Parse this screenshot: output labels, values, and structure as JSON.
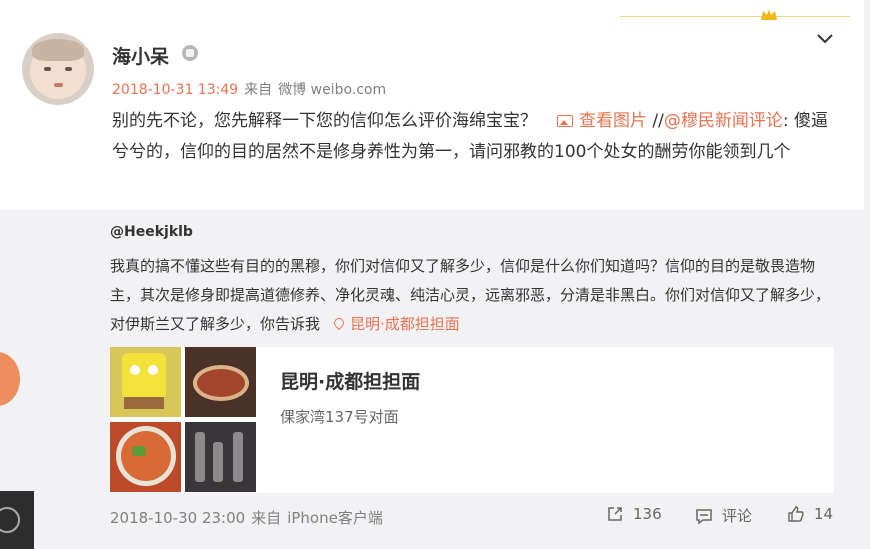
{
  "post": {
    "username": "海小呆",
    "time": "2018-10-31 13:49",
    "source_prefix": "来自",
    "source": "微博 weibo.com",
    "text_part1": "别的先不论，您先解释一下您的信仰怎么评价海绵宝宝？",
    "view_image": "查看图片",
    "slash": " //",
    "mention": "@穆民新闻评论",
    "text_part2": ": 傻逼兮兮的，信仰的目的居然不是修身养性为第一，请问邪教的100个处女的酬劳你能领到几个"
  },
  "repost": {
    "username": "@Heekjklb",
    "text": "我真的搞不懂这些有目的的黑穆，你们对信仰又了解多少，信仰是什么你们知道吗？信仰的目的是敬畏造物主，其次是修身即提高道德修养、净化灵魂、纯洁心灵，远离邪恶，分清是非黑白。你们对信仰又了解多少，对伊斯兰又了解多少，你告诉我",
    "location_link": "昆明·成都担担面",
    "location_card": {
      "title": "昆明·成都担担面",
      "address": "倮家湾137号对面"
    },
    "time": "2018-10-30 23:00",
    "source_prefix": "来自",
    "source": "iPhone客户端",
    "share_count": "136",
    "comment_label": "评论",
    "like_count": "14"
  },
  "icons": {
    "vip": "robot-badge-icon",
    "more": "chevron-down-icon",
    "image": "image-icon",
    "location": "location-pin-icon",
    "share": "share-icon",
    "comment": "comment-icon",
    "like": "thumbs-up-icon",
    "crown": "crown-icon"
  },
  "colors": {
    "accent": "#eb7350",
    "repost_bg": "#f2f2f5",
    "muted": "#808080"
  }
}
